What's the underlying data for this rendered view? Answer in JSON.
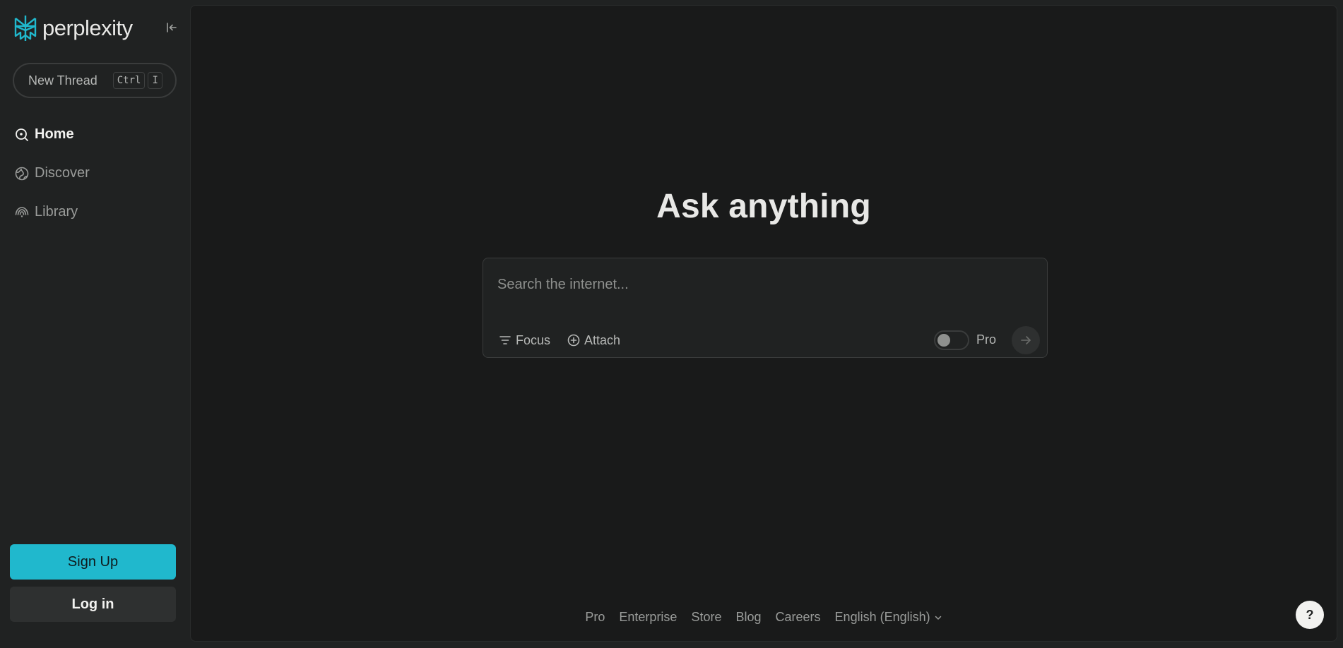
{
  "app": {
    "logo_text": "perplexity",
    "logo_icon": "perplexity-logo-icon",
    "accent_color": "#20b8cd"
  },
  "sidebar": {
    "collapse_icon": "collapse-sidebar-icon",
    "new_thread": {
      "label": "New Thread",
      "shortcut_keys": [
        "Ctrl",
        "I"
      ]
    },
    "nav_items": [
      {
        "label": "Home",
        "icon": "home-search-icon",
        "active": true
      },
      {
        "label": "Discover",
        "icon": "globe-icon",
        "active": false
      },
      {
        "label": "Library",
        "icon": "library-icon",
        "active": false
      }
    ],
    "sign_up_label": "Sign Up",
    "log_in_label": "Log in"
  },
  "main": {
    "title": "Ask anything",
    "search": {
      "placeholder": "Search the internet...",
      "value": "",
      "focus_label": "Focus",
      "attach_label": "Attach",
      "pro_label": "Pro",
      "pro_enabled": false
    },
    "footer_links": [
      "Pro",
      "Enterprise",
      "Store",
      "Blog",
      "Careers"
    ],
    "language": "English (English)",
    "help_label": "?"
  }
}
